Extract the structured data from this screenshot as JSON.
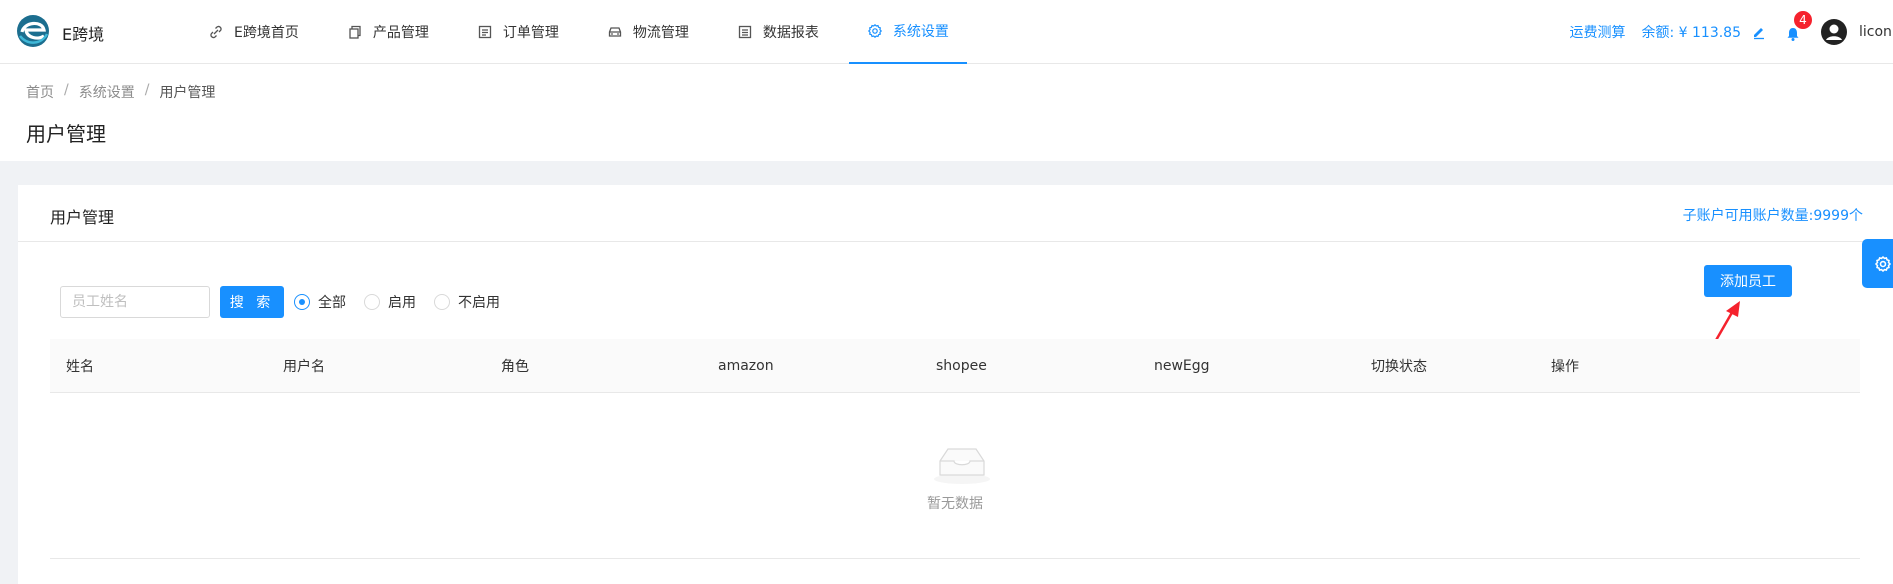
{
  "app": {
    "logo_text": "E跨境"
  },
  "nav": {
    "items": [
      {
        "label": "E跨境首页",
        "icon": "link-icon"
      },
      {
        "label": "产品管理",
        "icon": "copy-icon"
      },
      {
        "label": "订单管理",
        "icon": "list-icon"
      },
      {
        "label": "物流管理",
        "icon": "car-icon"
      },
      {
        "label": "数据报表",
        "icon": "report-icon"
      },
      {
        "label": "系统设置",
        "icon": "gear-icon",
        "active": true
      }
    ]
  },
  "header_right": {
    "freight_calc": "运费测算",
    "balance": "余额: ¥ 113.85",
    "notification_count": "4",
    "username": "licon"
  },
  "breadcrumb": {
    "home": "首页",
    "section": "系统设置",
    "current": "用户管理"
  },
  "page": {
    "title": "用户管理"
  },
  "card": {
    "title": "用户管理",
    "extra": "子账户可用账户数量:9999个",
    "search_placeholder": "员工姓名",
    "search_button": "搜 索",
    "radios": [
      {
        "label": "全部",
        "checked": true
      },
      {
        "label": "启用",
        "checked": false
      },
      {
        "label": "不启用",
        "checked": false
      }
    ],
    "add_button": "添加员工"
  },
  "table": {
    "columns": [
      "姓名",
      "用户名",
      "角色",
      "amazon",
      "shopee",
      "newEgg",
      "切换状态",
      "操作"
    ],
    "empty_text": "暂无数据"
  },
  "colors": {
    "primary": "#1890ff",
    "badge": "#f5222d",
    "annotation_arrow": "#f5222d"
  }
}
